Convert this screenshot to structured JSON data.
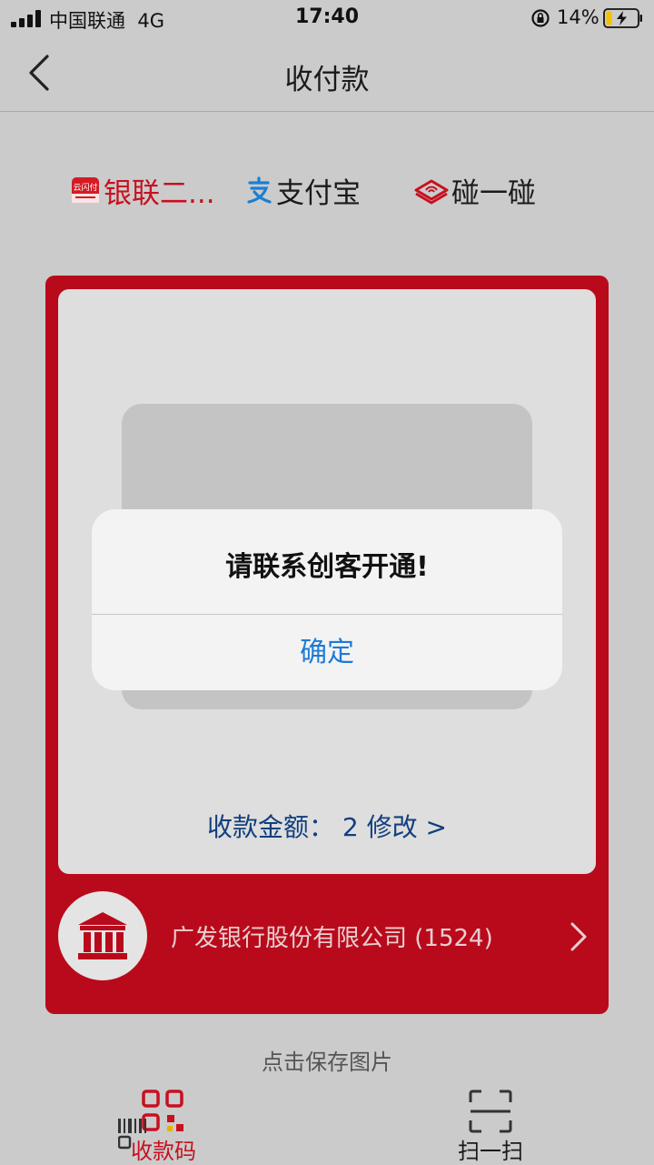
{
  "status_bar": {
    "carrier": "中国联通",
    "network": "4G",
    "time": "17:40",
    "battery": "14%"
  },
  "nav": {
    "title": "收付款"
  },
  "methods": [
    {
      "label": "银联二...",
      "icon": "unionpay-icon",
      "color": "#c8101f"
    },
    {
      "label": "支付宝",
      "icon": "alipay-icon",
      "color": "#1a1a1a"
    },
    {
      "label": "碰一碰",
      "icon": "tap-pay-icon",
      "color": "#1a1a1a"
    }
  ],
  "unionpay_badge_text": "云闪付",
  "card": {
    "amount_label": "收款金额：",
    "amount_value": "2",
    "edit_link": "修改 >",
    "bank_name": "广发银行股份有限公司 (1524)"
  },
  "save_hint": "点击保存图片",
  "tabs": [
    {
      "label": "收款码",
      "icon": "qr-code-icon",
      "active": true,
      "color": "#c8101f"
    },
    {
      "label": "扫一扫",
      "icon": "scan-icon",
      "active": false,
      "color": "#1a1a1a"
    }
  ],
  "dialog": {
    "message": "请联系创客开通!",
    "confirm": "确定"
  },
  "colors": {
    "brand_red": "#b90a1b",
    "link_blue": "#1f7ad6",
    "amount_blue": "#123f7e"
  }
}
